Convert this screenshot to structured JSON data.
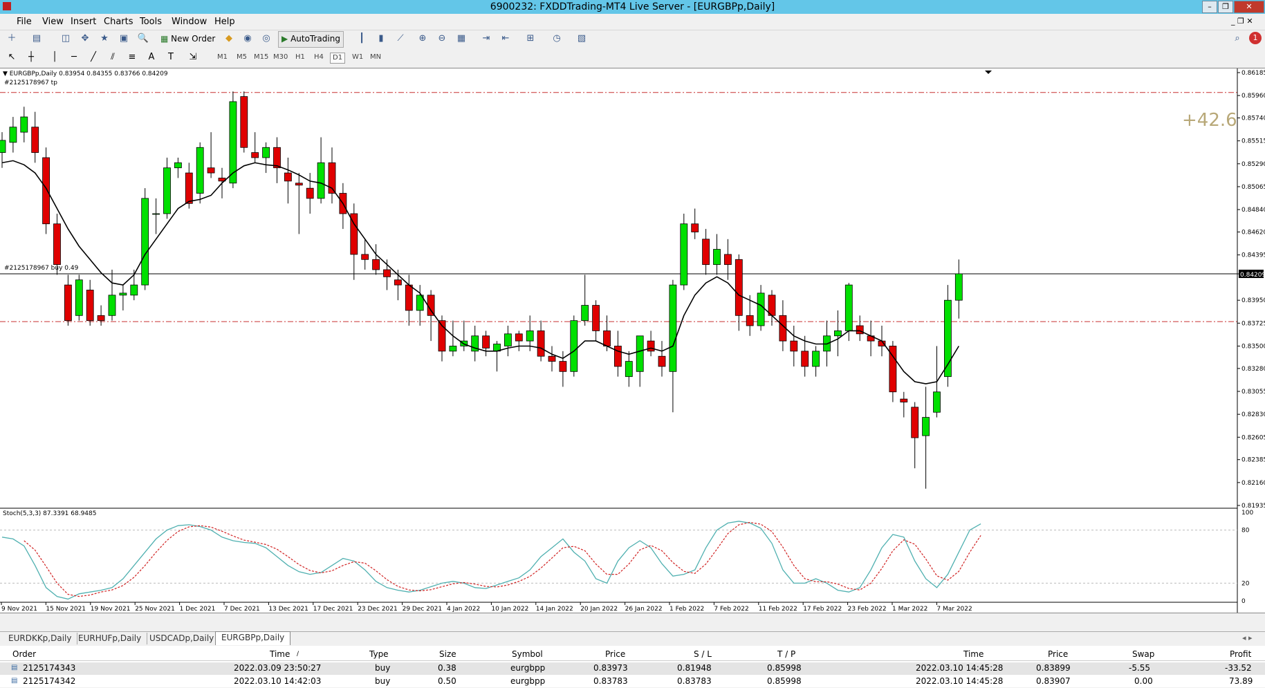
{
  "window": {
    "title": "6900232: FXDDTrading-MT4 Live Server - [EURGBPp,Daily]"
  },
  "menu": [
    "File",
    "View",
    "Insert",
    "Charts",
    "Tools",
    "Window",
    "Help"
  ],
  "toolbar": {
    "new_order": "New Order",
    "autotrading": "AutoTrading",
    "timeframes": [
      "M1",
      "M5",
      "M15",
      "M30",
      "H1",
      "H4",
      "D1",
      "W1",
      "MN"
    ],
    "selected_timeframe": "D1"
  },
  "chart": {
    "header": "EURGBPp,Daily  0.83954 0.84355 0.83766 0.84209",
    "tp_label": "#2125178967 tp",
    "buy_label": "#2125178967 buy 0.49",
    "profit_display": "+42.6",
    "current_price": "0.84209",
    "price_ticks": [
      "0.86185",
      "0.85960",
      "0.85740",
      "0.85515",
      "0.85290",
      "0.85065",
      "0.84840",
      "0.84620",
      "0.84395",
      "0.84209",
      "0.83950",
      "0.83725",
      "0.83500",
      "0.83280",
      "0.83055",
      "0.82830",
      "0.82605",
      "0.82385",
      "0.82160",
      "0.81935"
    ],
    "date_ticks": [
      "9 Nov 2021",
      "15 Nov 2021",
      "19 Nov 2021",
      "25 Nov 2021",
      "1 Dec 2021",
      "7 Dec 2021",
      "13 Dec 2021",
      "17 Dec 2021",
      "23 Dec 2021",
      "29 Dec 2021",
      "4 Jan 2022",
      "10 Jan 2022",
      "14 Jan 2022",
      "20 Jan 2022",
      "26 Jan 2022",
      "1 Feb 2022",
      "7 Feb 2022",
      "11 Feb 2022",
      "17 Feb 2022",
      "23 Feb 2022",
      "1 Mar 2022",
      "7 Mar 2022"
    ],
    "stoch_header": "Stoch(5,3,3) 87.3391 68.9485",
    "stoch_ticks": [
      "100",
      "80",
      "20",
      "0"
    ],
    "colors": {
      "bull": "#00e000",
      "bear": "#e00000",
      "ma": "#000000",
      "stoch_main": "#4fb0b0",
      "stoch_signal": "#d02020",
      "level_line": "#c83030"
    }
  },
  "chart_data": {
    "type": "candlestick",
    "symbol": "EURGBPp",
    "timeframe": "Daily",
    "y_range": [
      0.81935,
      0.86185
    ],
    "tp_level": 0.8599,
    "buy_level": 0.8374,
    "current_price": 0.84209,
    "candles": [
      [
        0.854,
        0.856,
        0.8525,
        0.8552
      ],
      [
        0.855,
        0.8575,
        0.854,
        0.8565
      ],
      [
        0.856,
        0.8585,
        0.855,
        0.8575
      ],
      [
        0.8565,
        0.858,
        0.853,
        0.854
      ],
      [
        0.8535,
        0.8545,
        0.846,
        0.847
      ],
      [
        0.847,
        0.848,
        0.842,
        0.843
      ],
      [
        0.841,
        0.842,
        0.837,
        0.8375
      ],
      [
        0.838,
        0.842,
        0.8375,
        0.8415
      ],
      [
        0.8405,
        0.8415,
        0.837,
        0.8375
      ],
      [
        0.838,
        0.839,
        0.837,
        0.8375
      ],
      [
        0.838,
        0.8425,
        0.8375,
        0.84
      ],
      [
        0.84,
        0.841,
        0.8385,
        0.8402
      ],
      [
        0.84,
        0.8425,
        0.8395,
        0.841
      ],
      [
        0.841,
        0.8505,
        0.8405,
        0.8495
      ],
      [
        0.848,
        0.8495,
        0.846,
        0.848
      ],
      [
        0.848,
        0.8535,
        0.8475,
        0.8525
      ],
      [
        0.8525,
        0.8535,
        0.8515,
        0.853
      ],
      [
        0.852,
        0.853,
        0.8485,
        0.849
      ],
      [
        0.85,
        0.855,
        0.849,
        0.8545
      ],
      [
        0.8525,
        0.856,
        0.8515,
        0.852
      ],
      [
        0.8515,
        0.8525,
        0.8495,
        0.8512
      ],
      [
        0.851,
        0.86,
        0.8505,
        0.859
      ],
      [
        0.8595,
        0.86,
        0.854,
        0.8545
      ],
      [
        0.854,
        0.856,
        0.853,
        0.8535
      ],
      [
        0.8535,
        0.855,
        0.852,
        0.8545
      ],
      [
        0.8545,
        0.8555,
        0.851,
        0.8525
      ],
      [
        0.852,
        0.8535,
        0.849,
        0.8512
      ],
      [
        0.851,
        0.852,
        0.846,
        0.8508
      ],
      [
        0.8505,
        0.852,
        0.848,
        0.8495
      ],
      [
        0.8495,
        0.8555,
        0.849,
        0.853
      ],
      [
        0.853,
        0.8545,
        0.849,
        0.85
      ],
      [
        0.85,
        0.851,
        0.8465,
        0.848
      ],
      [
        0.848,
        0.849,
        0.8415,
        0.844
      ],
      [
        0.844,
        0.8455,
        0.8425,
        0.8435
      ],
      [
        0.8435,
        0.845,
        0.842,
        0.8425
      ],
      [
        0.8425,
        0.8435,
        0.8405,
        0.8418
      ],
      [
        0.8415,
        0.8425,
        0.8395,
        0.841
      ],
      [
        0.841,
        0.842,
        0.837,
        0.8385
      ],
      [
        0.8385,
        0.841,
        0.837,
        0.84
      ],
      [
        0.84,
        0.8405,
        0.8355,
        0.838
      ],
      [
        0.8375,
        0.838,
        0.8335,
        0.8345
      ],
      [
        0.8345,
        0.8375,
        0.834,
        0.835
      ],
      [
        0.835,
        0.8375,
        0.8345,
        0.8355
      ],
      [
        0.8345,
        0.837,
        0.8335,
        0.836
      ],
      [
        0.836,
        0.8365,
        0.834,
        0.8348
      ],
      [
        0.8345,
        0.8355,
        0.8325,
        0.8352
      ],
      [
        0.835,
        0.837,
        0.834,
        0.8362
      ],
      [
        0.8362,
        0.8365,
        0.8345,
        0.8355
      ],
      [
        0.8355,
        0.838,
        0.8345,
        0.8365
      ],
      [
        0.8365,
        0.8375,
        0.8335,
        0.834
      ],
      [
        0.834,
        0.835,
        0.8325,
        0.8335
      ],
      [
        0.8335,
        0.8345,
        0.831,
        0.8325
      ],
      [
        0.8325,
        0.838,
        0.832,
        0.8375
      ],
      [
        0.8375,
        0.842,
        0.837,
        0.839
      ],
      [
        0.839,
        0.8395,
        0.8355,
        0.8365
      ],
      [
        0.8365,
        0.838,
        0.8345,
        0.835
      ],
      [
        0.835,
        0.8365,
        0.832,
        0.833
      ],
      [
        0.832,
        0.8345,
        0.831,
        0.8335
      ],
      [
        0.8325,
        0.836,
        0.831,
        0.836
      ],
      [
        0.8355,
        0.8365,
        0.834,
        0.8345
      ],
      [
        0.834,
        0.8355,
        0.832,
        0.833
      ],
      [
        0.8325,
        0.8415,
        0.8285,
        0.841
      ],
      [
        0.841,
        0.848,
        0.8405,
        0.847
      ],
      [
        0.847,
        0.8485,
        0.8455,
        0.8462
      ],
      [
        0.8455,
        0.8465,
        0.842,
        0.843
      ],
      [
        0.843,
        0.846,
        0.842,
        0.8445
      ],
      [
        0.844,
        0.8455,
        0.8415,
        0.843
      ],
      [
        0.8435,
        0.844,
        0.8365,
        0.838
      ],
      [
        0.838,
        0.84,
        0.836,
        0.837
      ],
      [
        0.837,
        0.841,
        0.8365,
        0.8402
      ],
      [
        0.84,
        0.8405,
        0.837,
        0.838
      ],
      [
        0.838,
        0.8395,
        0.8345,
        0.8355
      ],
      [
        0.8355,
        0.837,
        0.833,
        0.8345
      ],
      [
        0.8345,
        0.836,
        0.832,
        0.833
      ],
      [
        0.833,
        0.835,
        0.832,
        0.8345
      ],
      [
        0.8345,
        0.8375,
        0.833,
        0.836
      ],
      [
        0.836,
        0.8385,
        0.834,
        0.8365
      ],
      [
        0.8365,
        0.8412,
        0.8355,
        0.841
      ],
      [
        0.837,
        0.838,
        0.8355,
        0.8362
      ],
      [
        0.836,
        0.8375,
        0.834,
        0.8355
      ],
      [
        0.8355,
        0.837,
        0.834,
        0.835
      ],
      [
        0.835,
        0.8355,
        0.8295,
        0.8305
      ],
      [
        0.8298,
        0.8305,
        0.828,
        0.8295
      ],
      [
        0.829,
        0.8295,
        0.823,
        0.826
      ],
      [
        0.8262,
        0.831,
        0.821,
        0.828
      ],
      [
        0.8285,
        0.835,
        0.828,
        0.8305
      ],
      [
        0.832,
        0.841,
        0.831,
        0.8395
      ],
      [
        0.8395,
        0.8435,
        0.8377,
        0.8421
      ]
    ],
    "moving_average": [
      0.853,
      0.8532,
      0.8528,
      0.852,
      0.8505,
      0.8485,
      0.8465,
      0.8448,
      0.8435,
      0.8422,
      0.8412,
      0.841,
      0.842,
      0.844,
      0.8455,
      0.847,
      0.8485,
      0.8492,
      0.8494,
      0.8498,
      0.851,
      0.852,
      0.8527,
      0.853,
      0.8528,
      0.8527,
      0.8523,
      0.8518,
      0.8512,
      0.851,
      0.8505,
      0.849,
      0.847,
      0.8455,
      0.844,
      0.843,
      0.842,
      0.841,
      0.8402,
      0.8385,
      0.837,
      0.836,
      0.8352,
      0.8348,
      0.8345,
      0.8345,
      0.8348,
      0.835,
      0.835,
      0.8348,
      0.8342,
      0.8338,
      0.8345,
      0.8355,
      0.8355,
      0.835,
      0.8345,
      0.8342,
      0.8345,
      0.8348,
      0.8345,
      0.835,
      0.838,
      0.84,
      0.8412,
      0.8418,
      0.8412,
      0.84,
      0.8395,
      0.839,
      0.838,
      0.837,
      0.836,
      0.8355,
      0.8352,
      0.8352,
      0.8357,
      0.8365,
      0.8365,
      0.836,
      0.8355,
      0.834,
      0.8325,
      0.8315,
      0.8313,
      0.8315,
      0.8332,
      0.835
    ],
    "stochastic": {
      "main": [
        72,
        70,
        62,
        40,
        15,
        5,
        2,
        8,
        10,
        12,
        15,
        25,
        40,
        55,
        70,
        80,
        85,
        86,
        84,
        80,
        72,
        68,
        66,
        65,
        60,
        50,
        40,
        33,
        30,
        32,
        40,
        48,
        45,
        35,
        22,
        15,
        12,
        10,
        12,
        16,
        20,
        22,
        20,
        15,
        14,
        18,
        22,
        26,
        35,
        50,
        60,
        70,
        55,
        45,
        25,
        20,
        45,
        60,
        68,
        60,
        42,
        28,
        30,
        35,
        60,
        80,
        88,
        90,
        88,
        82,
        65,
        35,
        20,
        20,
        25,
        20,
        12,
        10,
        15,
        35,
        60,
        75,
        72,
        45,
        25,
        15,
        30,
        55,
        80,
        87
      ]
    },
    "stoch_signal_range": [
      0,
      100
    ]
  },
  "tabs": [
    "EURDKKp,Daily",
    "EURHUFp,Daily",
    "USDCADp,Daily",
    "EURGBPp,Daily"
  ],
  "active_tab": "EURGBPp,Daily",
  "terminal": {
    "headers": [
      "Order",
      "Time",
      "Type",
      "Size",
      "Symbol",
      "Price",
      "S / L",
      "T / P",
      "Time",
      "Price",
      "Swap",
      "Profit"
    ],
    "rows": [
      [
        "2125174343",
        "2022.03.09 23:50:27",
        "buy",
        "0.38",
        "eurgbpp",
        "0.83973",
        "0.81948",
        "0.85998",
        "2022.03.10 14:45:28",
        "0.83899",
        "-5.55",
        "-33.52"
      ],
      [
        "2125174342",
        "2022.03.10 14:42:03",
        "buy",
        "0.50",
        "eurgbpp",
        "0.83783",
        "0.83783",
        "0.85998",
        "2022.03.10 14:45:28",
        "0.83907",
        "0.00",
        "73.89"
      ]
    ]
  }
}
